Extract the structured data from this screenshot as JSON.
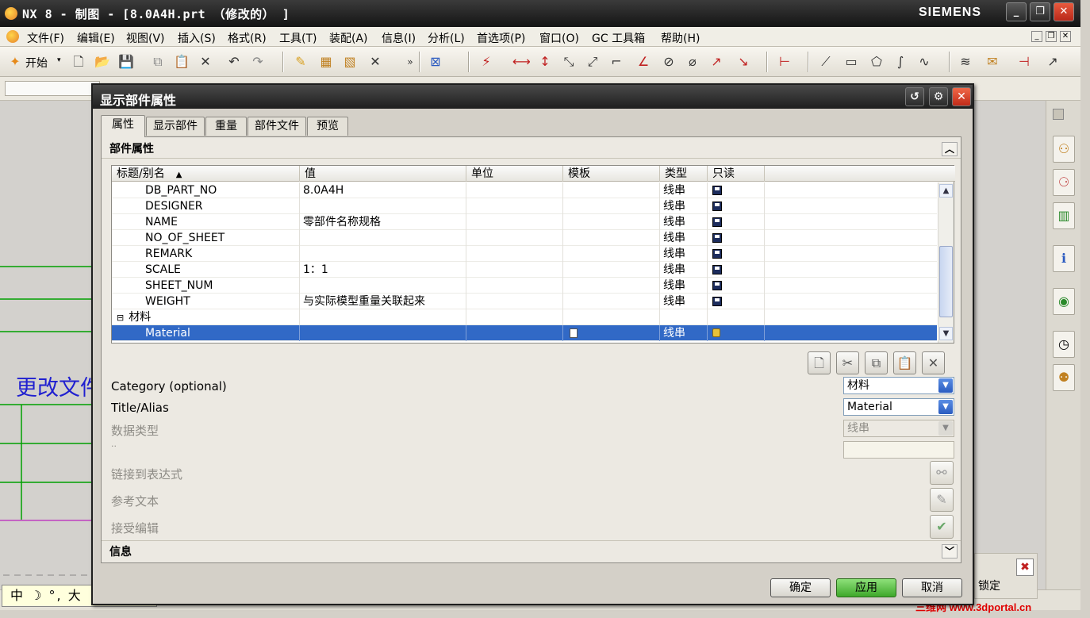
{
  "app": {
    "title": "NX 8 - 制图 - [8.0A4H.prt （修改的） ]",
    "brand": "SIEMENS"
  },
  "menu": [
    "文件(F)",
    "编辑(E)",
    "视图(V)",
    "插入(S)",
    "格式(R)",
    "工具(T)",
    "装配(A)",
    "信息(I)",
    "分析(L)",
    "首选项(P)",
    "窗口(O)",
    "GC 工具箱",
    "帮助(H)"
  ],
  "toolbar": {
    "start_label": "开始"
  },
  "canvas": {
    "drawing_text": "更改文件"
  },
  "status": {
    "lock_label": "锁定",
    "ime_text": "中 ☽ °, 大"
  },
  "watermark": "三维网 www.3dportal.cn",
  "dialog": {
    "title": "显示部件属性",
    "tabs": [
      "属性",
      "显示部件",
      "重量",
      "部件文件",
      "预览"
    ],
    "section_title": "部件属性",
    "columns": [
      "标题/别名",
      "值",
      "单位",
      "模板",
      "类型",
      "只读"
    ],
    "rows": [
      {
        "name": "DB_PART_NO",
        "value": "8.0A4H",
        "unit": "",
        "type": "线串"
      },
      {
        "name": "DESIGNER",
        "value": "",
        "unit": "",
        "type": "线串"
      },
      {
        "name": "NAME",
        "value": "零部件名称规格",
        "unit": "",
        "type": "线串"
      },
      {
        "name": "NO_OF_SHEET",
        "value": "",
        "unit": "",
        "type": "线串"
      },
      {
        "name": "REMARK",
        "value": "",
        "unit": "",
        "type": "线串"
      },
      {
        "name": "SCALE",
        "value": "1：1",
        "unit": "",
        "type": "线串"
      },
      {
        "name": "SHEET_NUM",
        "value": "",
        "unit": "",
        "type": "线串"
      },
      {
        "name": "WEIGHT",
        "value": "与实际模型重量关联起来",
        "unit": "",
        "type": "线串"
      }
    ],
    "group_label": "材料",
    "selected_row": {
      "name": "Material",
      "value": "",
      "type": "线串"
    },
    "fields": {
      "category_label": "Category (optional)",
      "category_value": "材料",
      "title_label": "Title/Alias",
      "title_value": "Material",
      "datatype_label": "数据类型",
      "datatype_value": "线串",
      "dots_label": "..",
      "link_label": "链接到表达式",
      "ref_label": "参考文本",
      "accept_label": "接受编辑"
    },
    "info_title": "信息",
    "buttons": {
      "ok": "确定",
      "apply": "应用",
      "cancel": "取消"
    }
  }
}
